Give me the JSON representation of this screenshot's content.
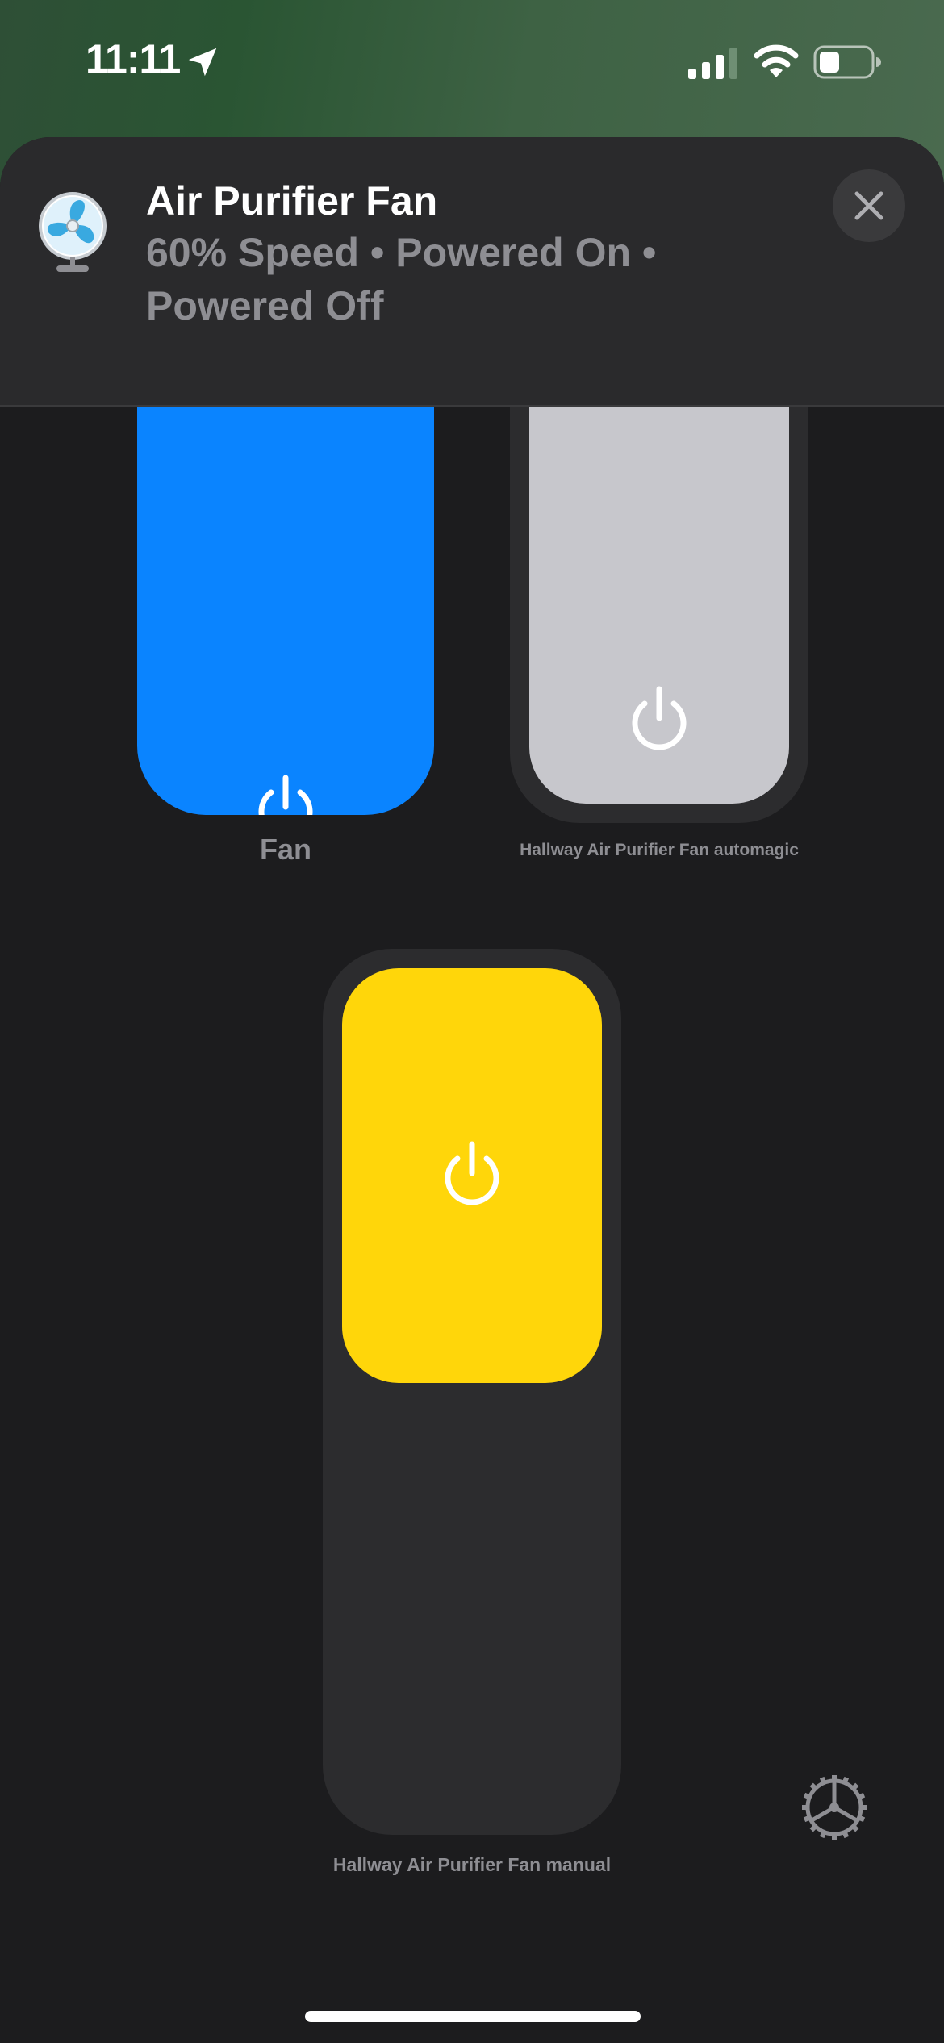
{
  "status_bar": {
    "time": "11:11",
    "location_icon": "location-arrow-icon",
    "signal_icon": "cellular-signal-icon",
    "wifi_icon": "wifi-icon",
    "battery_icon": "battery-icon"
  },
  "accessory": {
    "icon": "fan-icon",
    "title": "Air Purifier Fan",
    "status": "60% Speed • Powered On • Powered Off",
    "close_icon": "close-icon"
  },
  "tiles": [
    {
      "label": "Fan",
      "state": "on",
      "color": "#0a84ff",
      "level": 1.0
    },
    {
      "label": "Hallway Air Purifier Fan automagic",
      "state": "off",
      "color": "#c7c7cc"
    },
    {
      "label": "Hallway Air Purifier Fan manual",
      "state": "on",
      "color": "#ffd60a"
    }
  ],
  "settings_icon": "gear-icon",
  "colors": {
    "background": "#1c1c1e",
    "tile_background": "#2c2c2e",
    "secondary_text": "#8e8e93"
  }
}
